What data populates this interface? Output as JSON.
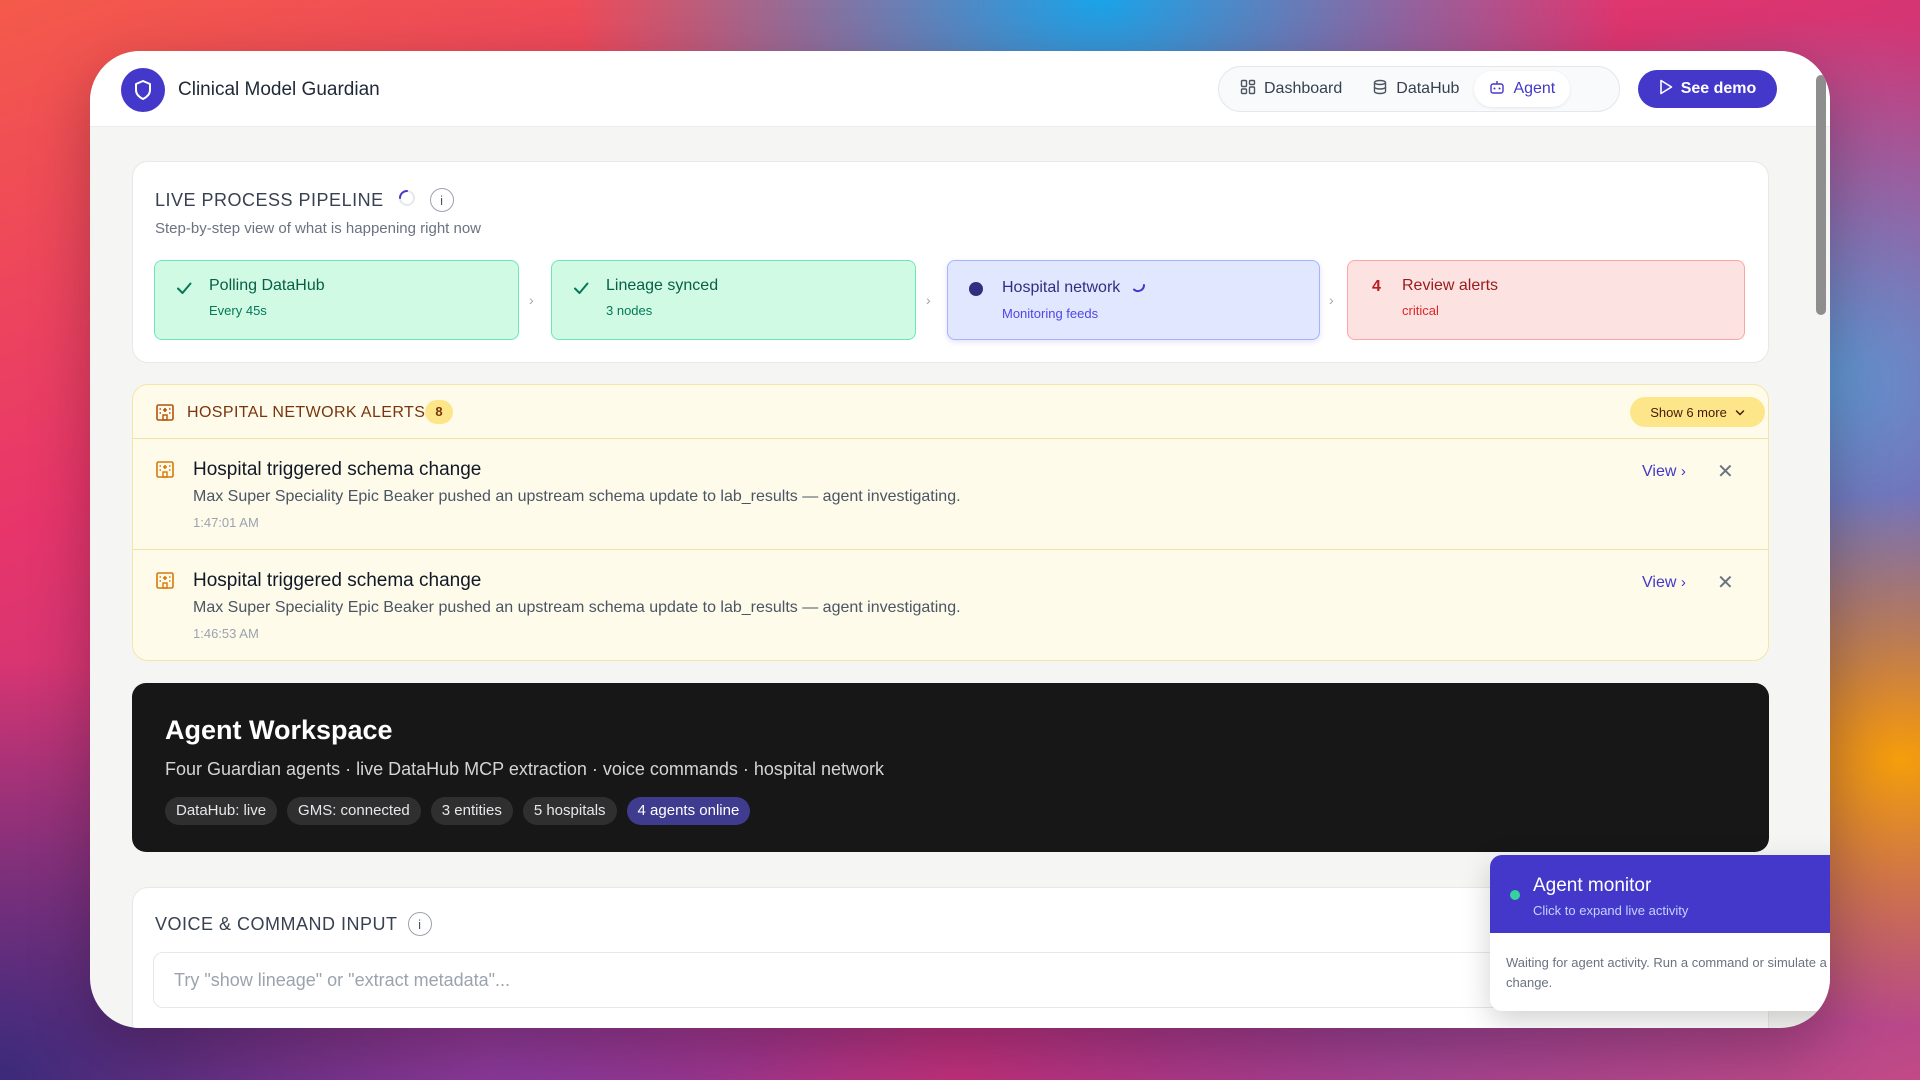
{
  "app": {
    "title": "Clinical Model Guardian"
  },
  "nav": {
    "items": [
      {
        "label": "Dashboard",
        "icon": "dashboard-grid-icon"
      },
      {
        "label": "DataHub",
        "icon": "database-icon"
      },
      {
        "label": "Agent",
        "icon": "robot-icon",
        "active": true
      }
    ],
    "demo_label": "See demo"
  },
  "pipeline": {
    "title": "LIVE PROCESS PIPELINE",
    "subtitle": "Step-by-step view of what is happening right now",
    "info": "i",
    "stages": [
      {
        "label": "Polling DataHub",
        "sub": "Every 45s",
        "status": "done"
      },
      {
        "label": "Lineage synced",
        "sub": "3 nodes",
        "status": "done"
      },
      {
        "label": "Hospital network",
        "sub": "Monitoring feeds",
        "status": "active"
      },
      {
        "label": "Review alerts",
        "sub": "critical",
        "count": "4",
        "status": "alert"
      }
    ]
  },
  "alerts": {
    "title": "HOSPITAL NETWORK ALERTS",
    "count": "8",
    "show_more": "Show 6 more",
    "items": [
      {
        "title": "Hospital triggered schema change",
        "desc": "Max Super Speciality Epic Beaker pushed an upstream schema update to lab_results — agent investigating.",
        "time": "1:47:01 AM",
        "view": "View"
      },
      {
        "title": "Hospital triggered schema change",
        "desc": "Max Super Speciality Epic Beaker pushed an upstream schema update to lab_results — agent investigating.",
        "time": "1:46:53 AM",
        "view": "View"
      }
    ]
  },
  "workspace": {
    "title": "Agent Workspace",
    "subtitle": "Four Guardian agents · live DataHub MCP extraction · voice commands · hospital network",
    "pills": [
      "DataHub: live",
      "GMS: connected",
      "3 entities",
      "5 hospitals",
      "4 agents online"
    ]
  },
  "voice": {
    "title": "VOICE & COMMAND INPUT",
    "info": "i",
    "placeholder": "Try \"show lineage\" or \"extract metadata\"..."
  },
  "monitor": {
    "title": "Agent monitor",
    "subtitle": "Click to expand live activity",
    "body": "Waiting for agent activity. Run a command or simulate a change."
  },
  "colors": {
    "brand": "#4338ca",
    "done_bg": "#d1fae5",
    "active_bg": "#e0e7ff",
    "alert_bg": "#fde2e2",
    "warning_bg": "#fefbea",
    "dark": "#171717"
  }
}
